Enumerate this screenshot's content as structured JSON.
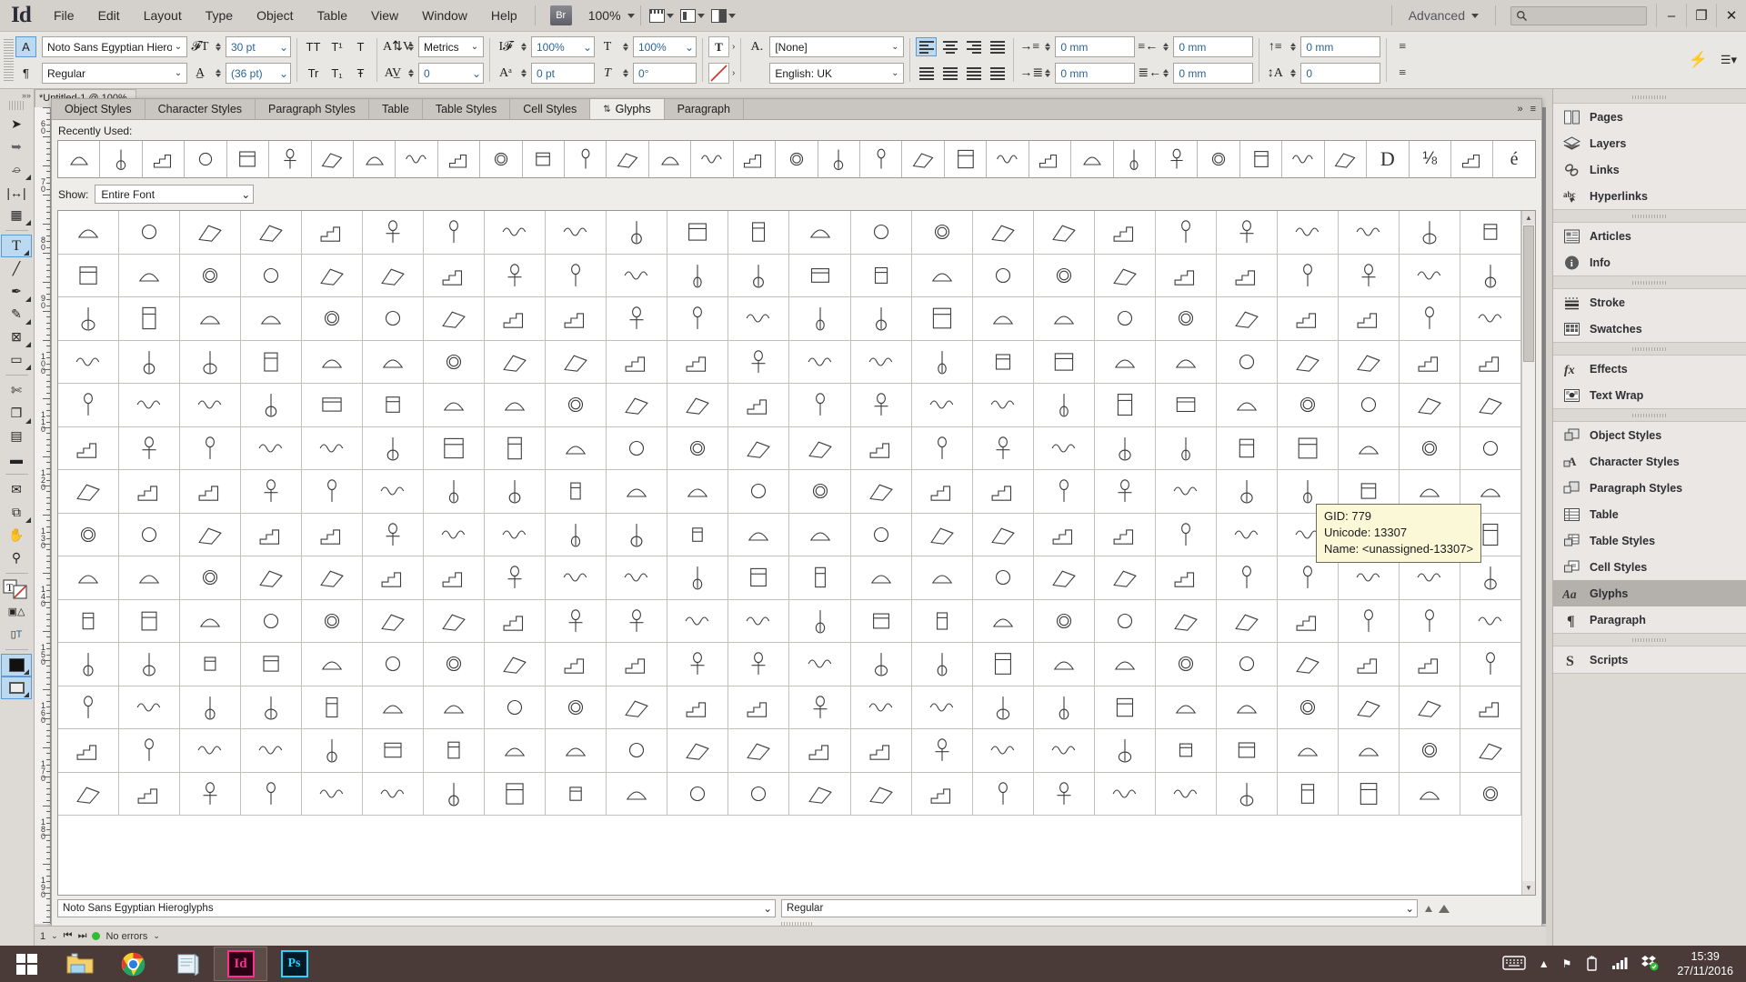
{
  "app": {
    "logo": "Id",
    "menus": [
      "File",
      "Edit",
      "Layout",
      "Type",
      "Object",
      "Table",
      "View",
      "Window",
      "Help"
    ],
    "bridge_label": "Br",
    "zoom_level": "100%",
    "workspace": "Advanced",
    "search_placeholder": "",
    "window_buttons": {
      "minimize": "–",
      "restore": "❐",
      "close": "✕"
    }
  },
  "control_bar": {
    "char_mode_label": "A",
    "para_mode_label": "¶",
    "font_family": "Noto Sans Egyptian Hieroglyp",
    "font_style": "Regular",
    "font_size": "30 pt",
    "leading": "(36 pt)",
    "kerning_mode": "Metrics",
    "tracking": "0",
    "case_buttons": [
      "TT",
      "T¹",
      "T"
    ],
    "case_buttons2": [
      "Tr",
      "T₁",
      "Ŧ"
    ],
    "horizontal_scale": "100%",
    "vertical_scale": "100%",
    "baseline_shift": "0 pt",
    "skew": "0°",
    "character_style": "[None]",
    "language": "English: UK",
    "left_indent": "0 mm",
    "right_indent": "0 mm",
    "first_line_indent": "0 mm",
    "last_line_indent": "0 mm",
    "space_before": "0 mm",
    "space_after": "0",
    "align_fields": [
      "0 mm",
      "0 mm",
      "0 mm",
      "0 mm",
      "0 mm",
      "0"
    ]
  },
  "toolbar": {
    "tools": [
      {
        "name": "selection-tool",
        "glyph": "➤"
      },
      {
        "name": "direct-selection-tool",
        "glyph": "➤"
      },
      {
        "name": "page-tool",
        "glyph": "◰"
      },
      {
        "name": "gap-tool",
        "glyph": "↔"
      },
      {
        "name": "content-collector-tool",
        "glyph": "☰"
      },
      {
        "name": "type-tool",
        "glyph": "T"
      },
      {
        "name": "line-tool",
        "glyph": "╱"
      },
      {
        "name": "pen-tool",
        "glyph": "✒"
      },
      {
        "name": "pencil-tool",
        "glyph": "✏"
      },
      {
        "name": "frame-tool",
        "glyph": "⌧"
      },
      {
        "name": "rectangle-tool",
        "glyph": "▭"
      },
      {
        "name": "scissors-tool",
        "glyph": "✂"
      },
      {
        "name": "free-transform-tool",
        "glyph": "⬚"
      },
      {
        "name": "gradient-swatch-tool",
        "glyph": "▤"
      },
      {
        "name": "gradient-feather-tool",
        "glyph": "▬"
      },
      {
        "name": "note-tool",
        "glyph": "὜9"
      },
      {
        "name": "eyedropper-tool",
        "glyph": "⚗"
      },
      {
        "name": "hand-tool",
        "glyph": "✋"
      },
      {
        "name": "zoom-tool",
        "glyph": "⚲"
      }
    ]
  },
  "document_tab": {
    "title": "*Untitled-1 @ 100%"
  },
  "glyphs_panel": {
    "tabs": [
      {
        "label": "Object Styles",
        "active": false
      },
      {
        "label": "Character Styles",
        "active": false
      },
      {
        "label": "Paragraph Styles",
        "active": false
      },
      {
        "label": "Table",
        "active": false
      },
      {
        "label": "Table Styles",
        "active": false
      },
      {
        "label": "Cell Styles",
        "active": false
      },
      {
        "label": "Glyphs",
        "active": true
      },
      {
        "label": "Paragraph",
        "active": false
      }
    ],
    "recently_used_label": "Recently Used:",
    "recently_used_count": 35,
    "show_label": "Show:",
    "show_value": "Entire Font",
    "footer_font": "Noto Sans Egyptian Hieroglyphs",
    "footer_style": "Regular",
    "grid_columns": 24,
    "grid_rows": 14
  },
  "tooltip": {
    "gid_label": "GID: 779",
    "unicode_label": "Unicode: 13307",
    "name_label": "Name: <unassigned-13307>"
  },
  "dock": {
    "groups": [
      {
        "items": [
          {
            "label": "Pages",
            "icon": "pages-icon"
          },
          {
            "label": "Layers",
            "icon": "layers-icon"
          },
          {
            "label": "Links",
            "icon": "links-icon"
          },
          {
            "label": "Hyperlinks",
            "icon": "hyperlinks-icon"
          }
        ]
      },
      {
        "items": [
          {
            "label": "Articles",
            "icon": "articles-icon"
          },
          {
            "label": "Info",
            "icon": "info-icon"
          }
        ]
      },
      {
        "items": [
          {
            "label": "Stroke",
            "icon": "stroke-icon"
          },
          {
            "label": "Swatches",
            "icon": "swatches-icon"
          }
        ]
      },
      {
        "items": [
          {
            "label": "Effects",
            "icon": "effects-icon"
          },
          {
            "label": "Text Wrap",
            "icon": "text-wrap-icon"
          }
        ]
      },
      {
        "items": [
          {
            "label": "Object Styles",
            "icon": "object-styles-icon"
          },
          {
            "label": "Character Styles",
            "icon": "character-styles-icon"
          },
          {
            "label": "Paragraph Styles",
            "icon": "paragraph-styles-icon"
          },
          {
            "label": "Table",
            "icon": "table-icon"
          },
          {
            "label": "Table Styles",
            "icon": "table-styles-icon"
          },
          {
            "label": "Cell Styles",
            "icon": "cell-styles-icon"
          },
          {
            "label": "Glyphs",
            "icon": "glyphs-icon",
            "selected": true
          },
          {
            "label": "Paragraph",
            "icon": "paragraph-icon"
          }
        ]
      },
      {
        "items": [
          {
            "label": "Scripts",
            "icon": "scripts-icon"
          }
        ]
      }
    ]
  },
  "status_bar": {
    "errors": "No errors",
    "page": "1"
  },
  "taskbar": {
    "apps": [
      {
        "name": "file-explorer",
        "label": "Explorer"
      },
      {
        "name": "google-chrome",
        "label": "Chrome"
      },
      {
        "name": "notepad",
        "label": "Notepad"
      },
      {
        "name": "indesign",
        "label": "Id",
        "active": true
      },
      {
        "name": "photoshop",
        "label": "Ps"
      }
    ],
    "time": "15:39",
    "date": "27/11/2016"
  },
  "colors": {
    "accent_blue": "#bcd9f2",
    "accent_blue_border": "#5b9bd5",
    "chrome_bg": "#d4d0cb",
    "panel_bg": "#efedea",
    "taskbar_bg": "#4a3b38",
    "tooltip_bg": "#fbf8d8",
    "value_text": "#2a6496",
    "dock_label": "#2f2f33"
  },
  "ruler": {
    "labels": [
      "60",
      "70",
      "80",
      "90",
      "100",
      "110",
      "120",
      "130",
      "140",
      "150",
      "160",
      "170",
      "180",
      "190"
    ]
  }
}
